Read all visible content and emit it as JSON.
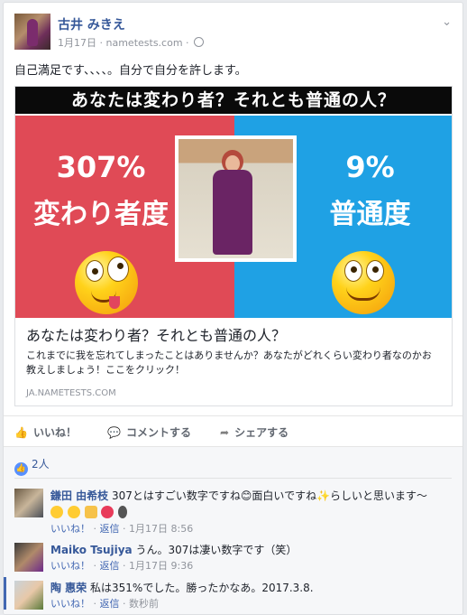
{
  "post": {
    "author": "古井 みきえ",
    "date": "1月17日",
    "source": "nametests.com",
    "text": "自己満足です、、、、。自分で自分を許します。"
  },
  "share": {
    "banner": "あなたは変わり者？それとも普通の人？",
    "left_value": "307%",
    "left_label": "変わり者度",
    "right_value": "9%",
    "right_label": "普通度",
    "title": "あなたは変わり者？それとも普通の人？",
    "description": "これまでに我を忘れてしまったことはありませんか？あなたがどれくらい変わり者なのかお教えしましょう！ここをクリック！",
    "domain": "JA.NAMETESTS.COM",
    "colors": {
      "left": "#e04a56",
      "right": "#1fa1e4"
    }
  },
  "actions": {
    "like": "いいね！",
    "comment": "コメントする",
    "share": "シェアする"
  },
  "likes_count": "2人",
  "comments": [
    {
      "name": "鎌田 由希枝",
      "text": "307とはすごい数字ですね😊面白いですね✨らしいと思います〜",
      "like": "いいね！",
      "reply": "返信",
      "time": "1月17日 8:56"
    },
    {
      "name": "Maiko Tsujiya",
      "text": "うん。307は凄い数字です（笑）",
      "like": "いいね！",
      "reply": "返信",
      "time": "1月17日 9:36"
    },
    {
      "name": "陶 惠荣",
      "text": "私は351%でした。勝ったかなあ。2017.3.8.",
      "like": "いいね！",
      "reply": "返信",
      "time": "数秒前"
    }
  ]
}
